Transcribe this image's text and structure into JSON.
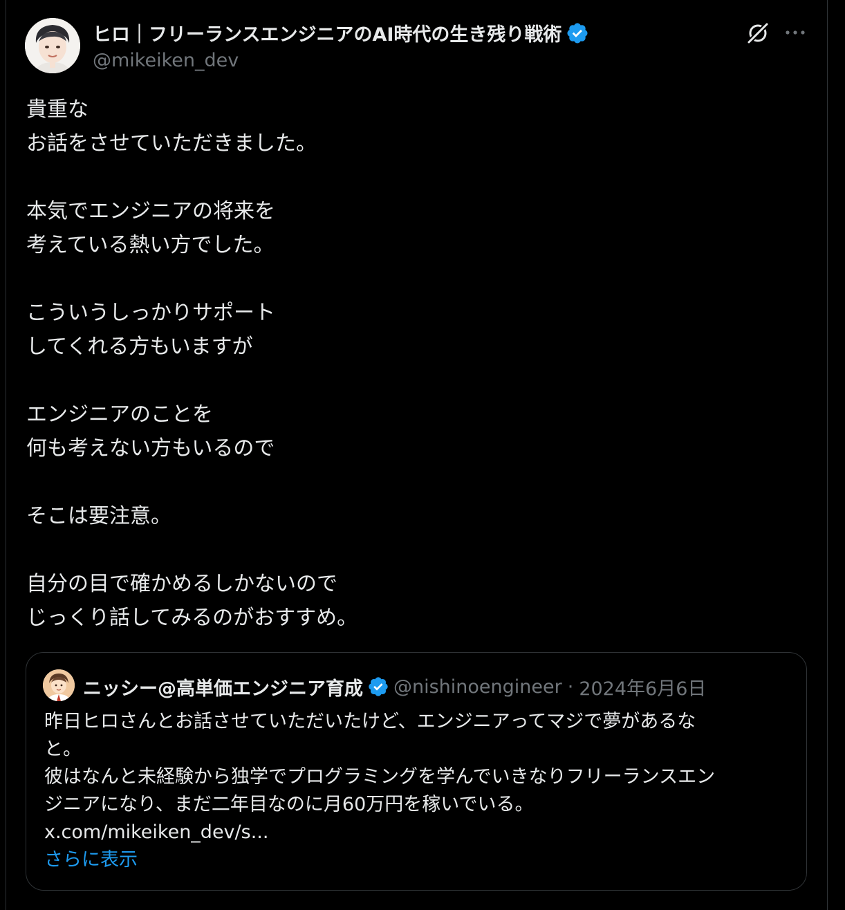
{
  "author": {
    "name": "ヒロ｜フリーランスエンジニアのAI時代の生き残り戦術",
    "handle": "@mikeiken_dev",
    "verified": true
  },
  "icons": {
    "verified": "verified-badge-icon",
    "grok": "grok-icon",
    "more": "more-icon"
  },
  "colors": {
    "background": "#000000",
    "text": "#e7e9ea",
    "secondary": "#71767b",
    "verified": "#1d9bf0",
    "link": "#1d9bf0",
    "border": "#2f3336"
  },
  "tweet": {
    "lines": [
      "貴重な",
      "お話をさせていただきました。",
      "",
      "本気でエンジニアの将来を",
      "考えている熱い方でした。",
      "",
      "こういうしっかりサポート",
      "してくれる方もいますが",
      "",
      "エンジニアのことを",
      "何も考えない方もいるので",
      "",
      "そこは要注意。",
      "",
      "自分の目で確かめるしかないので",
      "じっくり話してみるのがおすすめ。"
    ]
  },
  "quote": {
    "name": "ニッシー@高単価エンジニア育成",
    "handle": "@nishinoengineer",
    "separator": "·",
    "date": "2024年6月6日",
    "lines": [
      "昨日ヒロさんとお話させていただいたけど、エンジニアってマジで夢があるな",
      "と。",
      "彼はなんと未経験から独学でプログラミングを学んでいきなりフリーランスエン",
      "ジニアになり、まだ二年目なのに月60万円を稼いでいる。",
      "x.com/mikeiken_dev/s..."
    ],
    "show_more": "さらに表示"
  }
}
